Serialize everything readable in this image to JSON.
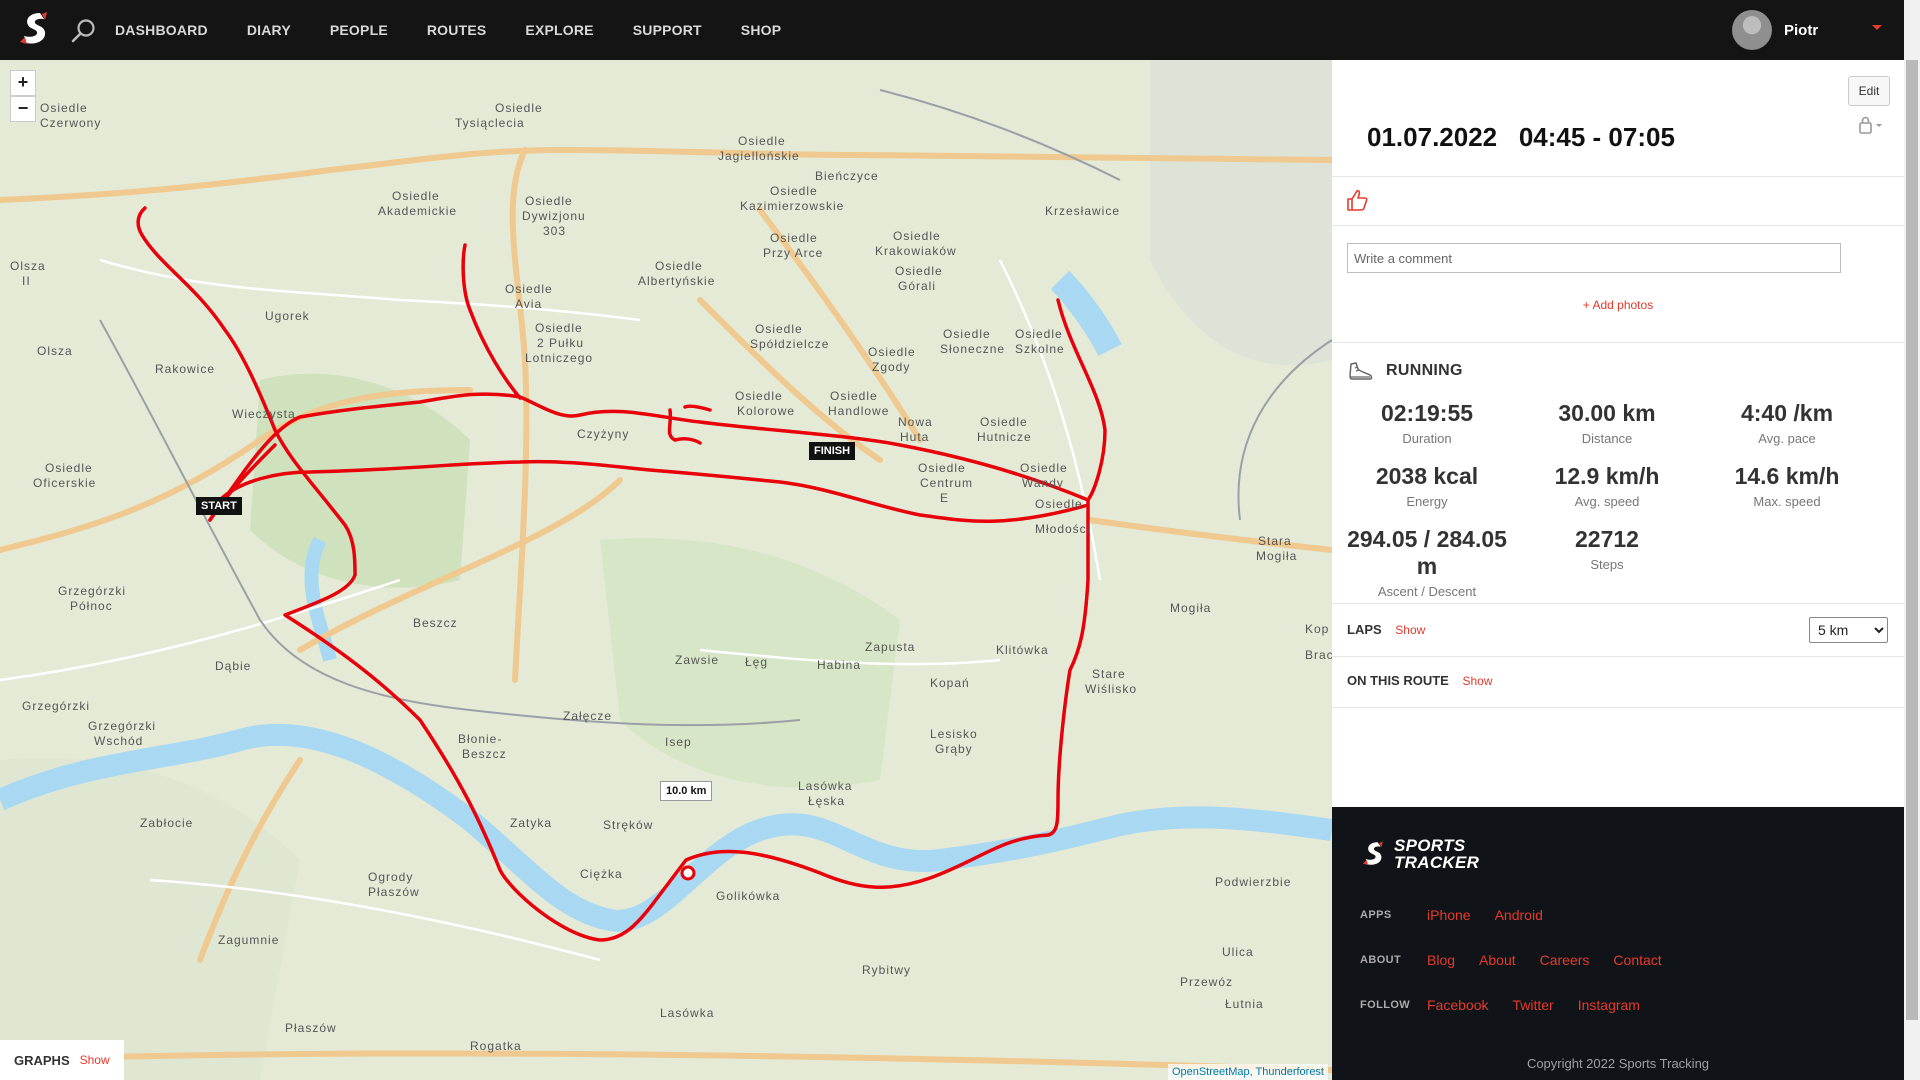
{
  "nav": {
    "items": [
      {
        "label": "DASHBOARD"
      },
      {
        "label": "DIARY"
      },
      {
        "label": "PEOPLE"
      },
      {
        "label": "ROUTES"
      },
      {
        "label": "EXPLORE"
      },
      {
        "label": "SUPPORT"
      },
      {
        "label": "SHOP"
      }
    ],
    "user_name": "Piotr"
  },
  "map": {
    "zoom_in": "+",
    "zoom_out": "−",
    "start_label": "START",
    "finish_label": "FINISH",
    "km_marker": "10.0 km",
    "attribution": "OpenStreetMap, Thunderforest",
    "graphs_label": "GRAPHS",
    "graphs_show": "Show",
    "place_labels": [
      "Osiedle",
      "Tysiąclecia",
      "Osiedle",
      "Jagiellońskie",
      "Bieńczyce",
      "Osiedle",
      "Kazimierzowskie",
      "Osiedle",
      "Akademickie",
      "Osiedle",
      "Dywizjonu",
      "303",
      "Osiedle",
      "Przy Arce",
      "Osiedle",
      "Krakowiaków",
      "Krzesławice",
      "Osiedle",
      "Albertyńskie",
      "Osiedle",
      "Górali",
      "Olsza",
      "II",
      "Osiedle",
      "Avia",
      "Ugorek",
      "Osiedle",
      "2 Pułku",
      "Lotniczego",
      "Osiedle",
      "Spółdzielcze",
      "Osiedle",
      "Zgody",
      "Osiedle",
      "Słoneczne",
      "Osiedle",
      "Szkolne",
      "Olsza",
      "Rakowice",
      "Wieczysta",
      "Osiedle",
      "Kolorowe",
      "Osiedle",
      "Handlowe",
      "Nowa",
      "Huta",
      "Osiedle",
      "Hutnicze",
      "Czyżyny",
      "Osiedle",
      "Oficerskie",
      "Osiedle",
      "Centrum",
      "E",
      "Osiedle",
      "Wandy",
      "Osiedle",
      "Młodości",
      "Stara",
      "Mogiła",
      "Grzegórzki",
      "Północ",
      "Beszcz",
      "Mogiła",
      "Zapusta",
      "Klitówka",
      "Dąbie",
      "Zawsie",
      "Łęg",
      "Habina",
      "Kopań",
      "Stare",
      "Wiślisko",
      "Grzegórzki",
      "Grzegórzki",
      "Wschód",
      "Załęcze",
      "Błonie-",
      "Beszcz",
      "Isep",
      "Lesisko",
      "Grąby",
      "Lasówka",
      "Łęska",
      "Zabłocie",
      "Zatyka",
      "Stręków",
      "Ciężka",
      "Ogrody",
      "Płaszów",
      "Golikówka",
      "Podwierzbie",
      "Zagumnie",
      "Ulica",
      "Rybitwy",
      "Przewóz",
      "Lasówka",
      "Łutnia",
      "Płaszów",
      "Rogatka",
      "Osiedle",
      "Czerwony",
      "Kop",
      "Brac"
    ]
  },
  "workout": {
    "edit_label": "Edit",
    "date": "01.07.2022",
    "time_range": "04:45 - 07:05",
    "comment_placeholder": "Write a comment",
    "add_photos": "+ Add photos",
    "activity": "RUNNING",
    "stats": [
      {
        "value": "02:19:55",
        "label": "Duration"
      },
      {
        "value": "30.00 km",
        "label": "Distance"
      },
      {
        "value": "4:40 /km",
        "label": "Avg. pace"
      },
      {
        "value": "2038 kcal",
        "label": "Energy"
      },
      {
        "value": "12.9 km/h",
        "label": "Avg. speed"
      },
      {
        "value": "14.6 km/h",
        "label": "Max. speed"
      },
      {
        "value": "294.05 / 284.05 m",
        "label": "Ascent / Descent"
      },
      {
        "value": "22712",
        "label": "Steps"
      }
    ],
    "laps_label": "LAPS",
    "laps_show": "Show",
    "lap_options": [
      "5 km"
    ],
    "lap_selected": "5 km",
    "route_label": "ON THIS ROUTE",
    "route_show": "Show"
  },
  "footer": {
    "logo_line1": "SPORTS",
    "logo_line2": "TRACKER",
    "apps_label": "APPS",
    "apps_links": [
      "iPhone",
      "Android"
    ],
    "about_label": "ABOUT",
    "about_links": [
      "Blog",
      "About",
      "Careers",
      "Contact"
    ],
    "follow_label": "FOLLOW",
    "follow_links": [
      "Facebook",
      "Twitter",
      "Instagram"
    ],
    "copyright": "Copyright 2022 Sports Tracking"
  },
  "colors": {
    "accent": "#e53a2c",
    "route": "#e8000b",
    "topbar": "#141414",
    "footer": "#101418",
    "river": "#a9d8f2",
    "map_base": "#e6ecd9"
  },
  "icons": [
    "sports-tracker-logo-icon",
    "search-icon",
    "chevron-down-icon",
    "lock-icon",
    "thumbs-up-icon",
    "running-shoe-icon"
  ]
}
